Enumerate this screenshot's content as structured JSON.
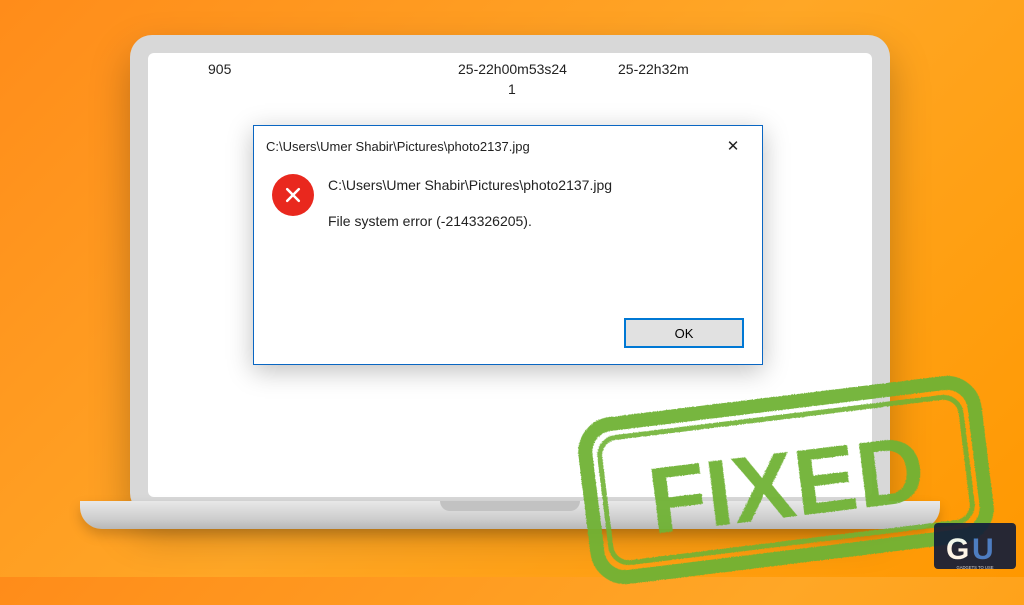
{
  "background": {
    "txt1": "905",
    "txt2": "25-22h00m53s24",
    "txt3": "1",
    "txt4": "25-22h32m"
  },
  "dialog": {
    "title": "C:\\Users\\Umer Shabir\\Pictures\\photo2137.jpg",
    "close_label": "✕",
    "path_line": "C:\\Users\\Umer Shabir\\Pictures\\photo2137.jpg",
    "error_line": "File system error (-2143326205).",
    "ok_label": "OK"
  },
  "stamp": {
    "text": "FIXED",
    "color": "#6fb336"
  },
  "logo": {
    "caption": "GADGETS TO USE"
  }
}
